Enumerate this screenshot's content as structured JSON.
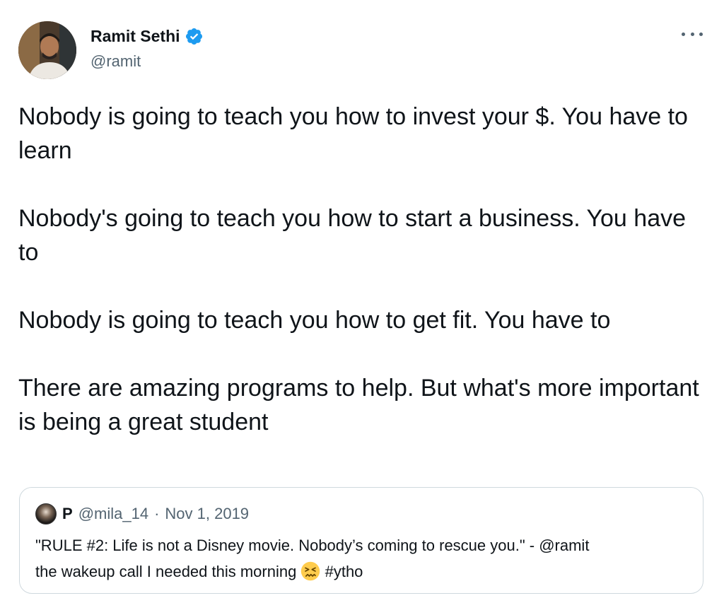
{
  "author": {
    "name": "Ramit Sethi",
    "handle": "@ramit",
    "verified": true
  },
  "icons": {
    "verified": "verified-badge-icon",
    "more": "more-options-icon",
    "emoji": "confounded-face-emoji"
  },
  "colors": {
    "verified": "#1d9bf0",
    "text": "#0f1419",
    "secondary": "#536471",
    "border": "#cfd9de"
  },
  "tweet": {
    "paragraphs": [
      "Nobody is going to teach you how to invest your $. You have to learn",
      "Nobody's going to teach you how to start a business. You have to",
      "Nobody is going to teach you how to get fit. You have to",
      "There are amazing programs to help. But what's more important is being a great student"
    ]
  },
  "quoted": {
    "name": "P",
    "handle": "@mila_14",
    "separator": "·",
    "date": "Nov 1, 2019",
    "line1": "\"RULE #2: Life is not a Disney movie. Nobody’s coming to rescue you.\" - @ramit",
    "line2_before_emoji": "the wakeup call I needed this morning",
    "line2_after_emoji": "#ytho"
  }
}
